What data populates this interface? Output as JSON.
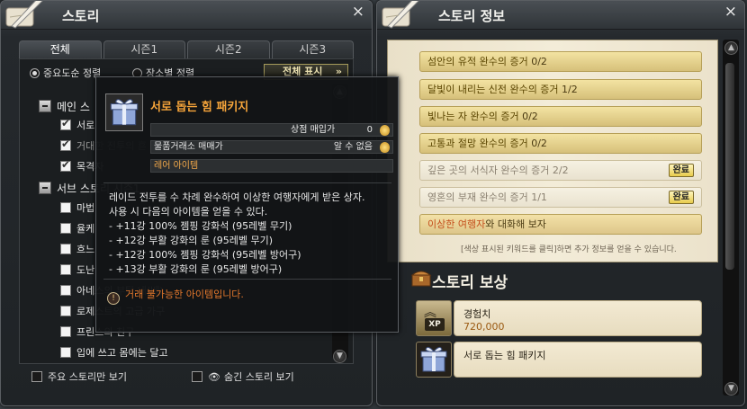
{
  "left_window": {
    "title": "스토리",
    "close": "×",
    "tabs": [
      "전체",
      "시즌1",
      "시즌2",
      "시즌3"
    ],
    "sort_importance": "중요도순 정렬",
    "sort_place": "장소별 정렬",
    "show_all": "전체 표시",
    "show_all_arrow": "»",
    "main_group": "메인 스",
    "main_items": [
      {
        "label": "서로",
        "checked": true
      },
      {
        "label": "거대한 전투의 흔",
        "checked": true
      },
      {
        "label": "목격자",
        "checked": true
      }
    ],
    "sub_group": "서브 스토리 시즌1",
    "sub_items": [
      {
        "label": "마법"
      },
      {
        "label": "율케"
      },
      {
        "label": "흐느"
      },
      {
        "label": "도난"
      },
      {
        "label": "아네스의 부탁 내(베)"
      },
      {
        "label": "로제스트의 고급 가구"
      },
      {
        "label": "프린스의 친구"
      },
      {
        "label": "입에 쓰고 몸에는 달고"
      }
    ],
    "footer_main_only": "주요 스토리만 보기",
    "footer_hidden": "숨긴 스토리 보기"
  },
  "right_window": {
    "title": "스토리 정보",
    "close": "×",
    "stories": [
      {
        "hl": "섬안의 유적 완수의 증거",
        "rest": " 0/2",
        "state": "gold"
      },
      {
        "hl": "달빛이 내리는 신전 완수의 증거",
        "rest": " 1/2",
        "state": "gold"
      },
      {
        "hl": "빛나는 자 완수의 증거",
        "rest": " 0/2",
        "state": "gold"
      },
      {
        "hl": "고통과 절망 완수의 증거",
        "rest": " 0/2",
        "state": "gold"
      },
      {
        "hl": "깊은 곳의 서식자 완수의 증거",
        "rest": " 2/2",
        "state": "done",
        "badge": "완료"
      },
      {
        "hl": "영혼의 부재 완수의 증거",
        "rest": " 1/1",
        "state": "done",
        "badge": "완료"
      },
      {
        "hl": "이상한 여행자",
        "rest": "와 대화해 보자",
        "state": "cur"
      }
    ],
    "hint": "[색상 표시된 키워드를 클릭]하면 추가 정보를 얻을 수 있습니다.",
    "reward_title": "스토리 보상",
    "rewards": [
      {
        "label": "경험치",
        "value": "720,000",
        "icon": "xp-icon",
        "icon_text": "XP"
      },
      {
        "label": "서로 돕는 힘 패키지",
        "value": "",
        "icon": "gift-box-icon"
      }
    ]
  },
  "tooltip": {
    "name": "서로 돕는 힘 패키지",
    "shop_label": "상점 매입가",
    "shop_value": "0",
    "trade_label": "물품거래소 매매가",
    "trade_value": "알 수 없음",
    "grade": "레어 아이템",
    "desc": [
      "레이드 전투를 수 차례 완수하여 이상한 여행자에게 받은 상자.",
      "사용 시 다음의 아이템을 얻을 수 있다.",
      "- +11강 100% 젬핑 강화석 (95레벨 무기)",
      "- +12강 부활 강화의 룬 (95레벨 무기)",
      "- +12강 100% 젬핑 강화석 (95레벨 방어구)",
      "- +13강 부활 강화의 룬 (95레벨 방어구)"
    ],
    "warning": "거래 불가능한 아이템입니다."
  },
  "colors": {
    "accent_gold": "#f7a53a",
    "warning": "#e4782c",
    "badge": "#e8cb4c"
  }
}
